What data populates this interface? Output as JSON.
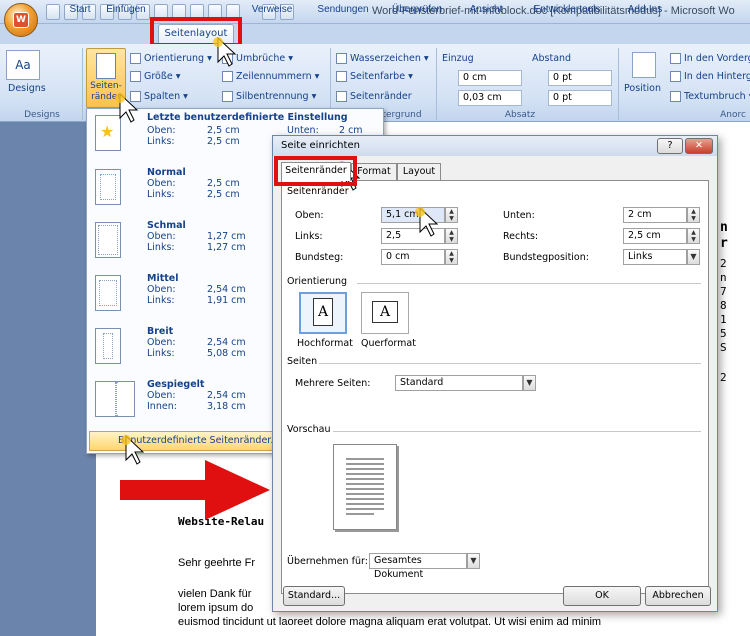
{
  "window": {
    "title": "Word-Fensterbrief-mit-Infoblock.doc [Kompatibilitätsmodus] - Microsoft Wo"
  },
  "tabs": [
    "Start",
    "Einfügen",
    "Seitenlayout",
    "Verweise",
    "Sendungen",
    "Überprüfen",
    "Ansicht",
    "Entwicklertools",
    "Add-Ins"
  ],
  "ribbon": {
    "designs": {
      "label": "Designs",
      "group": "Designs"
    },
    "seitenraender_btn": "Seiten-\nränder",
    "orientierung": "Orientierung",
    "groesse": "Größe",
    "spalten": "Spalten",
    "umbrueche": "Umbrüche",
    "zeilennummern": "Zeilennummern",
    "silbentrennung": "Silbentrennung",
    "wasserzeichen": "Wasserzeichen",
    "seitenfarbe": "Seitenfarbe",
    "seitenraender2": "Seitenränder",
    "hintergrund_group": "tergrund",
    "einzug": "Einzug",
    "einzug_left": "0 cm",
    "einzug_right": "0,03 cm",
    "abstand": "Abstand",
    "abstand_before": "0 pt",
    "abstand_after": "0 pt",
    "absatz_group": "Absatz",
    "position": "Position",
    "in_den_vordergrund": "In den Vorderg",
    "in_den_hintergrund": "In den Hinterg",
    "textumbruch": "Textumbruch",
    "anordnen_group": "Anorc"
  },
  "dropdown": {
    "items": [
      {
        "title": "Letzte benutzerdefinierte Einstellung",
        "l1": "Oben:",
        "v1": "2,5 cm",
        "l2": "Links:",
        "v2": "2,5 cm",
        "l3": "Unten:",
        "v3": "2 cm"
      },
      {
        "title": "Normal",
        "l1": "Oben:",
        "v1": "2,5 cm",
        "l2": "Links:",
        "v2": "2,5 cm"
      },
      {
        "title": "Schmal",
        "l1": "Oben:",
        "v1": "1,27 cm",
        "l2": "Links:",
        "v2": "1,27 cm"
      },
      {
        "title": "Mittel",
        "l1": "Oben:",
        "v1": "2,54 cm",
        "l2": "Links:",
        "v2": "1,91 cm"
      },
      {
        "title": "Breit",
        "l1": "Oben:",
        "v1": "2,54 cm",
        "l2": "Links:",
        "v2": "5,08 cm"
      },
      {
        "title": "Gespiegelt",
        "l1": "Oben:",
        "v1": "2,54 cm",
        "l2": "Innen:",
        "v2": "3,18 cm"
      }
    ],
    "custom": "Benutzerdefinierte Seitenränder..."
  },
  "dialog": {
    "title": "Seite einrichten",
    "tabs": [
      "Seitenränder",
      "Format",
      "Layout"
    ],
    "section_margins": "Seitenränder",
    "oben_label": "Oben:",
    "oben_value": "5,1 cm",
    "unten_label": "Unten:",
    "unten_value": "2 cm",
    "links_label": "Links:",
    "links_value": "2,5",
    "rechts_label": "Rechts:",
    "rechts_value": "2,5 cm",
    "bundsteg_label": "Bundsteg:",
    "bundsteg_value": "0 cm",
    "bundstegpos_label": "Bundstegposition:",
    "bundstegpos_value": "Links",
    "section_orientation": "Orientierung",
    "hochformat": "Hochformat",
    "querformat": "Querformat",
    "section_pages": "Seiten",
    "mehrere_label": "Mehrere Seiten:",
    "mehrere_value": "Standard",
    "section_preview": "Vorschau",
    "uebernehmen_label": "Übernehmen für:",
    "uebernehmen_value": "Gesamtes Dokument",
    "btn_standard": "Standard...",
    "btn_ok": "OK",
    "btn_cancel": "Abbrechen",
    "help": "?",
    "close": "✕"
  },
  "document": {
    "heading": "Website-Relau",
    "greeting": "Sehr geehrte Fr",
    "line1": "vielen Dank für",
    "line2": "lorem ipsum do",
    "line3": "euismod tincidunt  ut laoreet dolore magna aliquam  erat volutpat.  Ut wisi enim  ad minim",
    "right_chars": [
      "n",
      "r",
      "2",
      "n",
      "7",
      "8",
      "1",
      "5",
      "S",
      "2"
    ]
  },
  "colors": {
    "highlight": "#e01010",
    "arrow": "#e01010",
    "accent": "#15428b"
  }
}
